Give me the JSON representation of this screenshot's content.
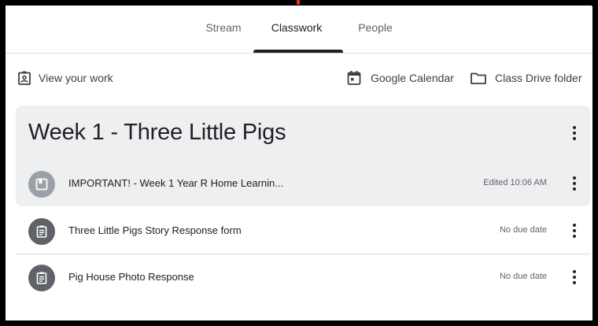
{
  "tabs": [
    {
      "label": "Stream"
    },
    {
      "label": "Classwork",
      "active": true
    },
    {
      "label": "People"
    }
  ],
  "toolbar": {
    "view_work_label": "View your work",
    "calendar_label": "Google Calendar",
    "drive_label": "Class Drive folder"
  },
  "topic": {
    "title": "Week 1 - Three Little Pigs"
  },
  "items": [
    {
      "title": "IMPORTANT! - Week 1 Year R Home Learnin...",
      "meta": "Edited 10:06 AM",
      "icon": "material-icon"
    },
    {
      "title": "Three Little Pigs Story Response form",
      "meta": "No due date",
      "icon": "assignment-icon"
    },
    {
      "title": "Pig House Photo Response",
      "meta": "No due date",
      "icon": "assignment-icon"
    }
  ],
  "colors": {
    "accent": "#202124",
    "highlight": "#eeeff1",
    "material_icon_bg": "#9aa0a6",
    "assignment_icon_bg": "#5f6368",
    "frame": "#000000",
    "red_mark": "#e8341c"
  }
}
